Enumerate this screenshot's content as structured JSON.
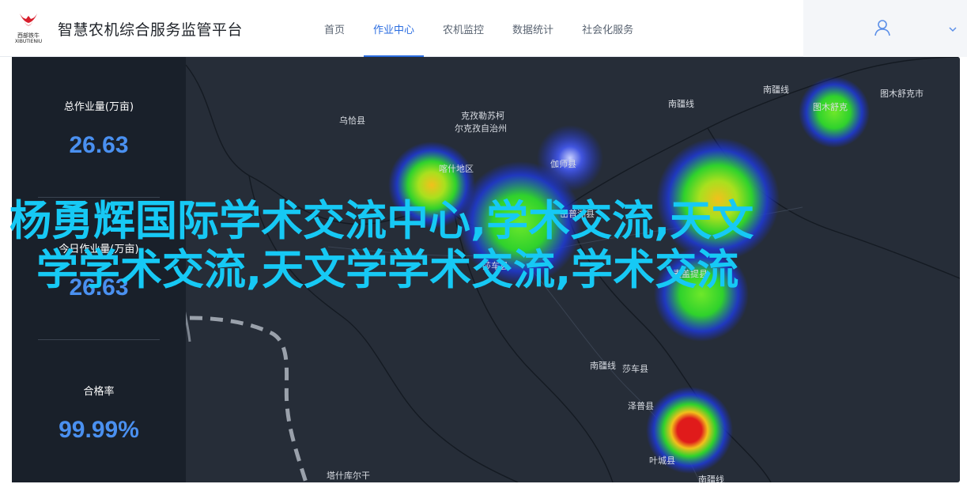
{
  "header": {
    "logo_cn": "西部铁牛",
    "logo_en": "XIBUTIENIU",
    "title": "智慧农机综合服务监管平台",
    "nav": [
      {
        "label": "首页",
        "active": false
      },
      {
        "label": "作业中心",
        "active": true
      },
      {
        "label": "农机监控",
        "active": false
      },
      {
        "label": "数据统计",
        "active": false
      },
      {
        "label": "社会化服务",
        "active": false
      }
    ],
    "user_icon": "user-icon",
    "dropdown_icon": "chevron-down-icon"
  },
  "stats": [
    {
      "label": "总作业量(万亩)",
      "value": "26.63"
    },
    {
      "label": "今日作业量(万亩)",
      "value": "26.63"
    },
    {
      "label": "合格率",
      "value": "99.99%"
    }
  ],
  "map": {
    "labels": [
      "乌恰县",
      "克孜勒苏柯",
      "尔克孜自治州",
      "喀什地区",
      "伽师县",
      "岳普湖县",
      "南疆线",
      "南疆线",
      "图木舒克市",
      "图木舒克",
      "莎车县",
      "麦盖提县",
      "南疆线",
      "莎车县",
      "泽普县",
      "叶城县",
      "塔什库尔干",
      "南疆线"
    ],
    "hotspot_colors": {
      "low": "#1a2fd6",
      "mid": "#33d62a",
      "high": "#f2c01c",
      "peak": "#e01b1b"
    }
  },
  "overlay": {
    "line1": "杨勇辉国际学术交流中心,学术交流,天文",
    "line2": "学学术交流,天文学学术交流,学术交流"
  }
}
